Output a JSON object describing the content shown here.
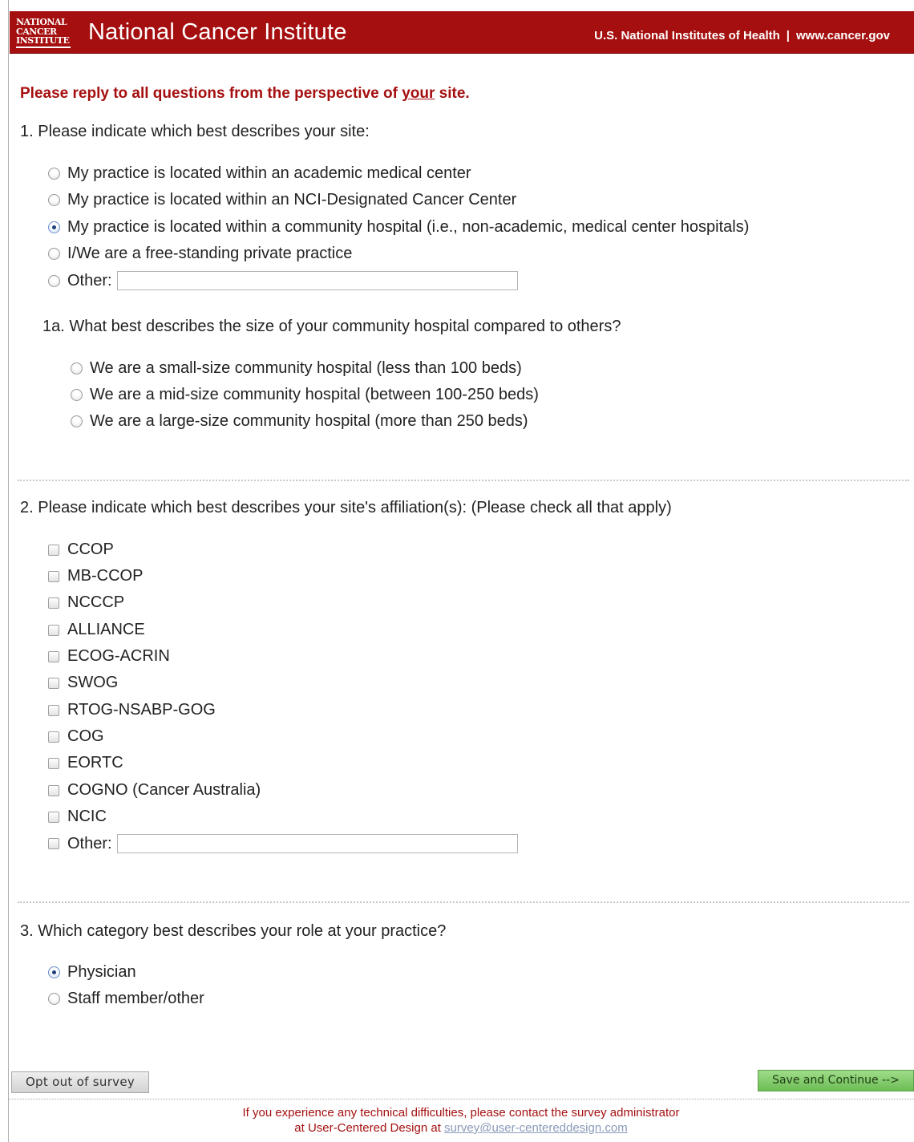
{
  "header": {
    "logo_lines": [
      "NATIONAL",
      "CANCER",
      "INSTITUTE"
    ],
    "org_name": "National Cancer Institute",
    "nih_link": "U.S. National Institutes of Health",
    "separator": "|",
    "site_link": "www.cancer.gov"
  },
  "instruction": {
    "before": "Please reply to all questions from the perspective of ",
    "emphasis": "your",
    "after": " site."
  },
  "q1": {
    "text": "1. Please indicate which best describes your site:",
    "options": [
      {
        "label": "My practice is located within an academic medical center",
        "checked": false
      },
      {
        "label": "My practice is located within an NCI-Designated Cancer Center",
        "checked": false
      },
      {
        "label": "My practice is located within a community hospital (i.e., non-academic, medical center hospitals)",
        "checked": true
      },
      {
        "label": "I/We are a free-standing private practice",
        "checked": false
      },
      {
        "label": "Other:",
        "checked": false
      }
    ],
    "other_value": ""
  },
  "q1a": {
    "text": "1a. What best describes the size of your community hospital compared to others?",
    "options": [
      {
        "label": "We are a small-size community hospital (less than 100 beds)",
        "checked": false
      },
      {
        "label": "We are a mid-size community hospital (between 100-250 beds)",
        "checked": false
      },
      {
        "label": "We are a large-size community hospital (more than 250 beds)",
        "checked": false
      }
    ]
  },
  "q2": {
    "text": "2. Please indicate which best describes your site's affiliation(s): (Please check all that apply)",
    "options": [
      {
        "label": "CCOP",
        "checked": false
      },
      {
        "label": "MB-CCOP",
        "checked": false
      },
      {
        "label": "NCCCP",
        "checked": false
      },
      {
        "label": "ALLIANCE",
        "checked": false
      },
      {
        "label": "ECOG-ACRIN",
        "checked": false
      },
      {
        "label": "SWOG",
        "checked": false
      },
      {
        "label": "RTOG-NSABP-GOG",
        "checked": false
      },
      {
        "label": "COG",
        "checked": false
      },
      {
        "label": "EORTC",
        "checked": false
      },
      {
        "label": "COGNO (Cancer Australia)",
        "checked": false
      },
      {
        "label": "NCIC",
        "checked": false
      },
      {
        "label": "Other:",
        "checked": false
      }
    ],
    "other_value": ""
  },
  "q3": {
    "text": "3. Which category best describes your role at your practice?",
    "options": [
      {
        "label": "Physician",
        "checked": true
      },
      {
        "label": "Staff member/other",
        "checked": false
      }
    ]
  },
  "buttons": {
    "opt_out": "Opt out of survey",
    "save": "Save and Continue -->"
  },
  "footer": {
    "line1": "If you experience any technical difficulties, please contact the survey administrator",
    "line2_prefix": "at User-Centered Design at ",
    "email": "survey@user-centereddesign.com"
  },
  "colors": {
    "brand_red": "#a50f0f",
    "save_green": "#7cc765"
  }
}
